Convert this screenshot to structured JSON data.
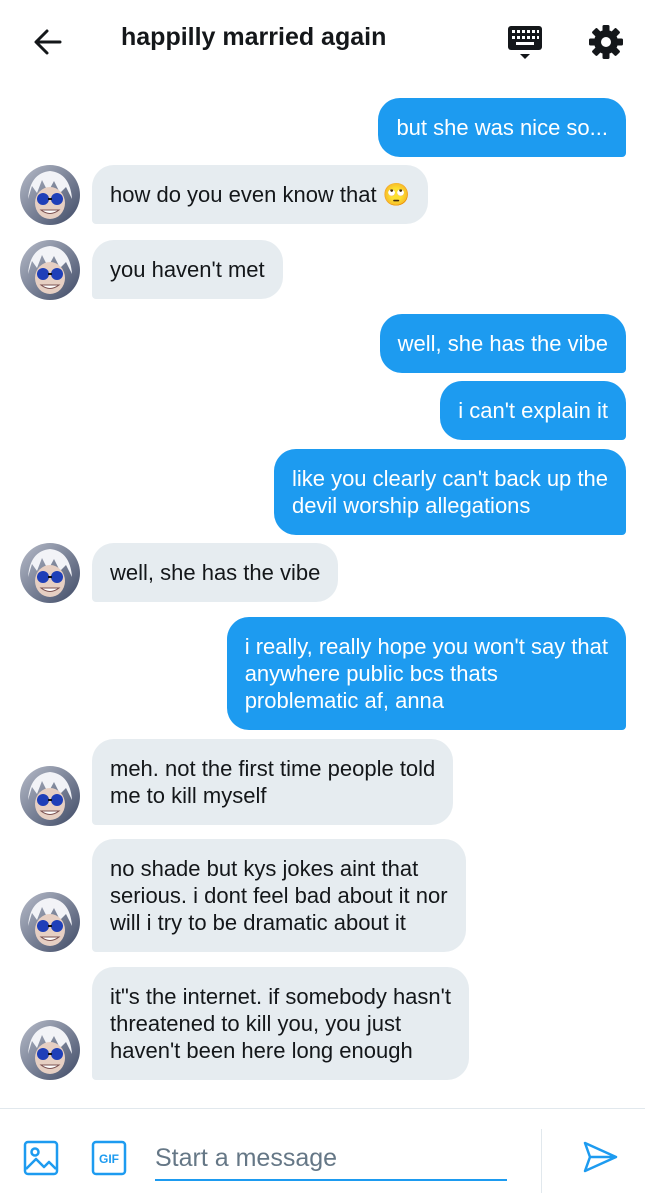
{
  "header": {
    "title": "happilly married again",
    "icons": {
      "back": "arrow-left-icon",
      "keyboard": "keyboard-icon",
      "settings": "gear-icon"
    }
  },
  "colors": {
    "accent": "#1d9bf0",
    "incoming_bubble": "#e6ecf0",
    "text": "#14171a",
    "muted": "#657786"
  },
  "messages": [
    {
      "dir": "out",
      "lines": [
        "but she was nice so..."
      ]
    },
    {
      "dir": "in",
      "lines": [
        "how do you even know that 🙄"
      ]
    },
    {
      "dir": "in",
      "lines": [
        "you haven't met"
      ]
    },
    {
      "dir": "out",
      "lines": [
        "well, she has the vibe"
      ]
    },
    {
      "dir": "out",
      "lines": [
        "i can't explain it"
      ]
    },
    {
      "dir": "out",
      "lines": [
        "like you clearly can't back up the",
        "devil worship allegations"
      ]
    },
    {
      "dir": "in",
      "lines": [
        "well, she has the vibe"
      ]
    },
    {
      "dir": "out",
      "lines": [
        "i really, really hope you won't say that",
        "anywhere public bcs thats",
        "problematic af, anna"
      ]
    },
    {
      "dir": "in",
      "lines": [
        "meh. not the first time people told",
        "me to kill myself"
      ]
    },
    {
      "dir": "in",
      "lines": [
        "no shade but kys jokes aint that",
        "serious. i dont feel bad about it nor",
        "will i try to be dramatic about it"
      ]
    },
    {
      "dir": "in",
      "lines": [
        "it\"s the internet. if somebody hasn't",
        "threatened to kill you, you just",
        "haven't been here long enough"
      ]
    }
  ],
  "composer": {
    "placeholder": "Start a message",
    "value": "",
    "gif_label": "GIF",
    "icons": {
      "image": "image-icon",
      "gif": "gif-icon",
      "send": "send-icon"
    }
  }
}
